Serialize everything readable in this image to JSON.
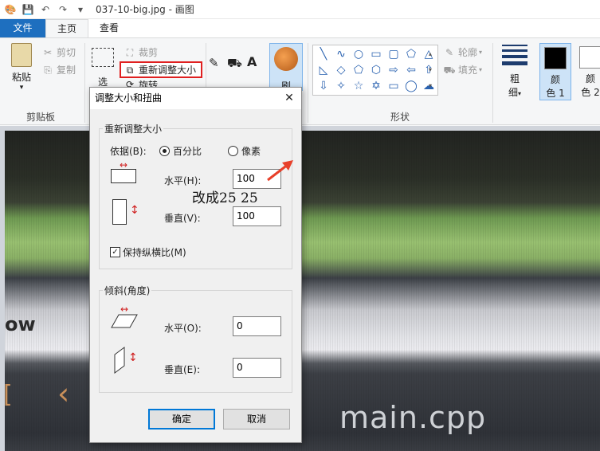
{
  "window": {
    "title": "037-10-big.jpg - 画图"
  },
  "tabs": [
    {
      "label": "文件"
    },
    {
      "label": "主页"
    },
    {
      "label": "查看"
    }
  ],
  "ribbon": {
    "clipboard": {
      "paste": "粘贴",
      "cut": "剪切",
      "copy": "复制",
      "group": "剪贴板"
    },
    "image": {
      "select": "选",
      "crop": "裁剪",
      "resize": "重新调整大小",
      "rotate": "旋转"
    },
    "brushes": {
      "label": "刷"
    },
    "shapes": {
      "outline": "轮廓",
      "fill": "填充",
      "group": "形状"
    },
    "size": {
      "label1": "粗",
      "label2": "细"
    },
    "colors": {
      "color1_a": "颜",
      "color1_b": "色 1",
      "color2_a": "颜",
      "color2_b": "色 2",
      "color1_hex": "#000000",
      "color2_hex": "#ffffff"
    }
  },
  "dialog": {
    "title": "调整大小和扭曲",
    "resize_group": "重新调整大小",
    "basis_label": "依据(B):",
    "percent_label": "百分比",
    "pixels_label": "像素",
    "horizontal_label": "水平(H):",
    "horizontal_value": "100",
    "vertical_label": "垂直(V):",
    "vertical_value": "100",
    "keep_ratio_label": "保持纵横比(M)",
    "skew_group": "倾斜(角度)",
    "skew_horizontal_label": "水平(O):",
    "skew_horizontal_value": "0",
    "skew_vertical_label": "垂直(E):",
    "skew_vertical_value": "0",
    "ok": "确定",
    "cancel": "取消"
  },
  "annotation": {
    "text": "改成25    25",
    "arrow_color": "#e8402a",
    "highlight_color": "#e02020"
  },
  "photo": {
    "big_text": "main.cpp",
    "low_text": "ow"
  }
}
